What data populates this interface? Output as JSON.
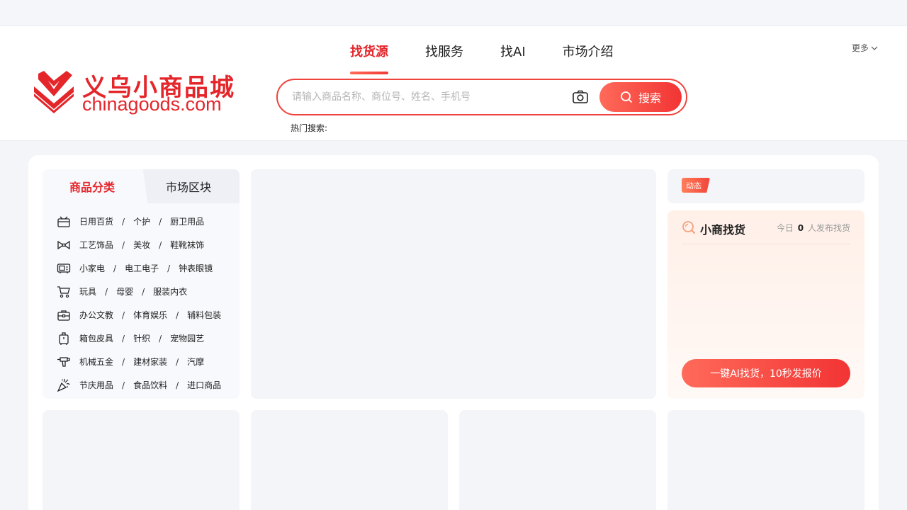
{
  "brand": {
    "name_cn": "义乌小商品城",
    "name_en": "chinagoods.com",
    "accent": "#e4262b"
  },
  "nav": {
    "tabs": [
      {
        "label": "找货源",
        "active": true
      },
      {
        "label": "找服务",
        "active": false
      },
      {
        "label": "找AI",
        "active": false
      },
      {
        "label": "市场介绍",
        "active": false
      }
    ],
    "more_label": "更多"
  },
  "search": {
    "placeholder": "请输入商品名称、商位号、姓名、手机号",
    "value": "",
    "button_label": "搜索",
    "hot_label": "热门搜索:"
  },
  "categories": {
    "tabs": [
      {
        "label": "商品分类",
        "active": true
      },
      {
        "label": "市场区块",
        "active": false
      }
    ],
    "rows": [
      {
        "icon": "daily-goods-icon",
        "items": [
          "日用百货",
          "个护",
          "厨卫用品"
        ]
      },
      {
        "icon": "bow-tie-icon",
        "items": [
          "工艺饰品",
          "美妆",
          "鞋靴袜饰"
        ]
      },
      {
        "icon": "appliance-icon",
        "items": [
          "小家电",
          "电工电子",
          "钟表眼镜"
        ]
      },
      {
        "icon": "stroller-icon",
        "items": [
          "玩具",
          "母婴",
          "服装内衣"
        ]
      },
      {
        "icon": "briefcase-icon",
        "items": [
          "办公文教",
          "体育娱乐",
          "辅料包装"
        ]
      },
      {
        "icon": "luggage-icon",
        "items": [
          "箱包皮具",
          "针织",
          "宠物园艺"
        ]
      },
      {
        "icon": "drill-icon",
        "items": [
          "机械五金",
          "建材家装",
          "汽摩"
        ]
      },
      {
        "icon": "party-popper-icon",
        "items": [
          "节庆用品",
          "食品饮料",
          "进口商品"
        ]
      }
    ]
  },
  "news": {
    "badge": "动态"
  },
  "finder": {
    "title": "小商找货",
    "stat_prefix": "今日",
    "stat_count": "0",
    "stat_suffix": "人发布找货",
    "button_label": "一键AI找货，10秒发报价"
  }
}
